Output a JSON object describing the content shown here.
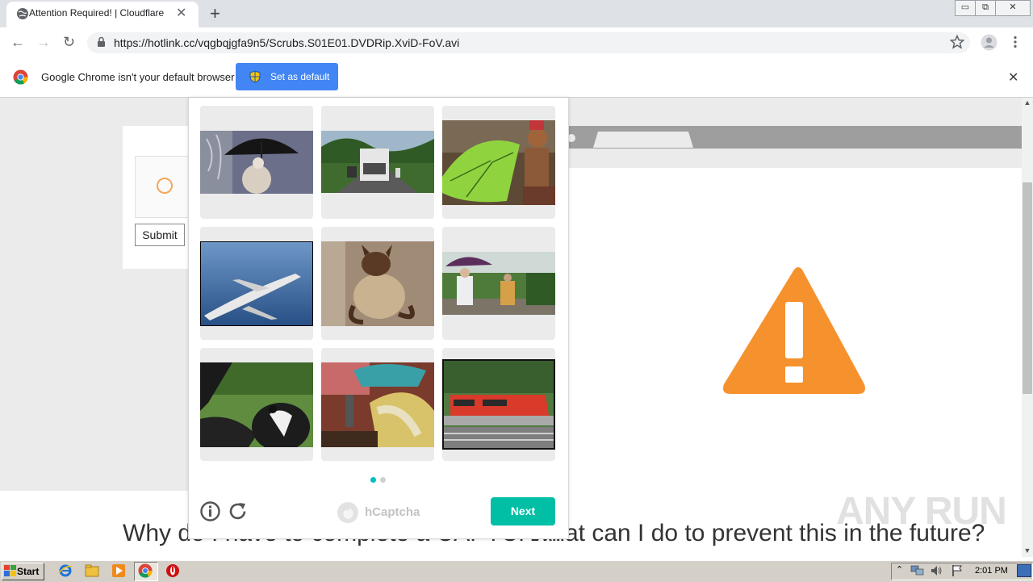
{
  "browser": {
    "tab_title": "Attention Required! | Cloudflare",
    "tab_close": "✕",
    "new_tab": "+",
    "url": "https://hotlink.cc/vqgbqjgfa9n5/Scrubs.S01E01.DVDRip.XviD-FoV.avi",
    "back": "←",
    "forward": "→",
    "reload": "↻",
    "window_min": "▭",
    "window_max": "⧉",
    "window_close": "✕"
  },
  "infobar": {
    "message": "Google Chrome isn't your default browser",
    "set_default_label": "Set as default",
    "close": "✕"
  },
  "page": {
    "submit_label": "Submit",
    "heading_left": "Why do I have to complete a CAPTCHA?",
    "heading_right": "What can I do to prevent this in the future?"
  },
  "hcaptcha": {
    "brand": "hCaptcha",
    "next_label": "Next",
    "images": [
      "umbrella-person",
      "garbage-truck",
      "green-umbrella-sock-monkey",
      "airplane",
      "siamese-cat",
      "people-with-umbrella",
      "dog-in-car",
      "people-umbrella-crowd",
      "red-train"
    ],
    "page_dots": 2,
    "active_dot": 1
  },
  "watermark": "ANY RUN",
  "taskbar": {
    "start_label": "Start",
    "clock": "2:01 PM"
  },
  "colors": {
    "warning_orange": "#f6922e",
    "next_teal": "#00bfa5",
    "chrome_blue": "#4285f4"
  }
}
